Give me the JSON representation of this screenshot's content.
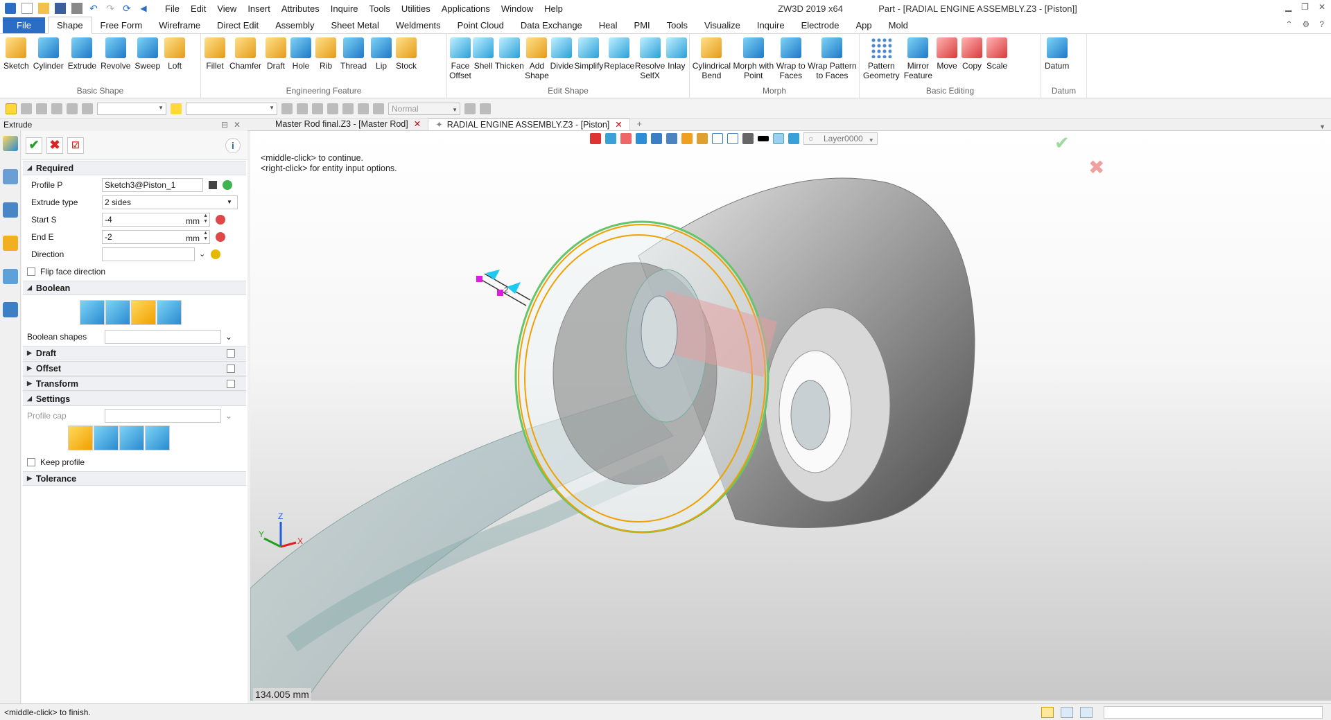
{
  "menu": [
    "File",
    "Edit",
    "View",
    "Insert",
    "Attributes",
    "Inquire",
    "Tools",
    "Utilities",
    "Applications",
    "Window",
    "Help"
  ],
  "window_title": {
    "app": "ZW3D 2019  x64",
    "doc": "Part - [RADIAL ENGINE ASSEMBLY.Z3 - [Piston]]"
  },
  "ribbon_tabs": [
    "File",
    "Shape",
    "Free Form",
    "Wireframe",
    "Direct Edit",
    "Assembly",
    "Sheet Metal",
    "Weldments",
    "Point Cloud",
    "Data Exchange",
    "Heal",
    "PMI",
    "Tools",
    "Visualize",
    "Inquire",
    "Electrode",
    "App",
    "Mold"
  ],
  "active_tab": "Shape",
  "ribbon_groups": [
    {
      "title": "Basic Shape",
      "buttons": [
        {
          "label": "Sketch",
          "icon": "sketch-icon",
          "color": "orange"
        },
        {
          "label": "Cylinder",
          "icon": "cylinder-icon",
          "color": "blue"
        },
        {
          "label": "Extrude",
          "icon": "extrude-icon",
          "color": "blue"
        },
        {
          "label": "Revolve",
          "icon": "revolve-icon",
          "color": "blue"
        },
        {
          "label": "Sweep",
          "icon": "sweep-icon",
          "color": "blue"
        },
        {
          "label": "Loft",
          "icon": "loft-icon",
          "color": "orange"
        }
      ]
    },
    {
      "title": "Engineering Feature",
      "buttons": [
        {
          "label": "Fillet",
          "icon": "fillet-icon",
          "color": "orange"
        },
        {
          "label": "Chamfer",
          "icon": "chamfer-icon",
          "color": "orange"
        },
        {
          "label": "Draft",
          "icon": "draft-icon",
          "color": "orange"
        },
        {
          "label": "Hole",
          "icon": "hole-icon",
          "color": "blue"
        },
        {
          "label": "Rib",
          "icon": "rib-icon",
          "color": "orange"
        },
        {
          "label": "Thread",
          "icon": "thread-icon",
          "color": "blue"
        },
        {
          "label": "Lip",
          "icon": "lip-icon",
          "color": "blue"
        },
        {
          "label": "Stock",
          "icon": "stock-icon",
          "color": "orange"
        }
      ]
    },
    {
      "title": "Edit Shape",
      "buttons": [
        {
          "label": "Face\nOffset",
          "icon": "face-offset-icon",
          "color": "cyan"
        },
        {
          "label": "Shell",
          "icon": "shell-icon",
          "color": "cyan"
        },
        {
          "label": "Thicken",
          "icon": "thicken-icon",
          "color": "cyan"
        },
        {
          "label": "Add\nShape",
          "icon": "add-shape-icon",
          "color": "orange"
        },
        {
          "label": "Divide",
          "icon": "divide-icon",
          "color": "cyan"
        },
        {
          "label": "Simplify",
          "icon": "simplify-icon",
          "color": "cyan"
        },
        {
          "label": "Replace",
          "icon": "replace-icon",
          "color": "cyan"
        },
        {
          "label": "Resolve\nSelfX",
          "icon": "resolve-selfx-icon",
          "color": "cyan"
        },
        {
          "label": "Inlay",
          "icon": "inlay-icon",
          "color": "cyan"
        }
      ]
    },
    {
      "title": "Morph",
      "buttons": [
        {
          "label": "Cylindrical\nBend",
          "icon": "cylindrical-bend-icon",
          "color": "orange"
        },
        {
          "label": "Morph with\nPoint",
          "icon": "morph-point-icon",
          "color": "blue"
        },
        {
          "label": "Wrap to\nFaces",
          "icon": "wrap-faces-icon",
          "color": "blue"
        },
        {
          "label": "Wrap Pattern\nto Faces",
          "icon": "wrap-pattern-icon",
          "color": "blue"
        }
      ]
    },
    {
      "title": "Basic Editing",
      "buttons": [
        {
          "label": "Pattern\nGeometry",
          "icon": "pattern-geometry-icon",
          "color": "grid"
        },
        {
          "label": "Mirror\nFeature",
          "icon": "mirror-feature-icon",
          "color": "blue"
        },
        {
          "label": "Move",
          "icon": "move-icon",
          "color": "red"
        },
        {
          "label": "Copy",
          "icon": "copy-icon",
          "color": "red"
        },
        {
          "label": "Scale",
          "icon": "scale-icon",
          "color": "red"
        }
      ]
    },
    {
      "title": "Datum",
      "buttons": [
        {
          "label": "Datum",
          "icon": "datum-icon",
          "color": "blue"
        }
      ]
    }
  ],
  "toolbar2": {
    "render_mode": "Normal"
  },
  "panel": {
    "title": "Extrude",
    "required_title": "Required",
    "profile_label": "Profile P",
    "profile_value": "Sketch3@Piston_1",
    "extrude_type_label": "Extrude type",
    "extrude_type_value": "2 sides",
    "start_label": "Start S",
    "start_value": "-4",
    "start_unit": "mm",
    "end_label": "End E",
    "end_value": "-2",
    "end_unit": "mm",
    "direction_label": "Direction",
    "flip_label": "Flip face direction",
    "boolean_title": "Boolean",
    "boolean_shapes_label": "Boolean shapes",
    "draft_title": "Draft",
    "offset_title": "Offset",
    "transform_title": "Transform",
    "settings_title": "Settings",
    "profile_cap_label": "Profile cap",
    "keep_profile_label": "Keep profile",
    "tolerance_title": "Tolerance"
  },
  "doc_tabs": [
    "Master Rod final.Z3 - [Master Rod]",
    "RADIAL ENGINE ASSEMBLY.Z3 - [Piston]"
  ],
  "viewport": {
    "hint1": "<middle-click> to continue.",
    "hint2": "<right-click> for entity input options.",
    "layer": "Layer0000",
    "distance": "134.005 mm",
    "axis_x": "X",
    "axis_y": "Y",
    "axis_z": "Z",
    "marker_label": "2"
  },
  "status": {
    "message": "<middle-click> to finish."
  }
}
